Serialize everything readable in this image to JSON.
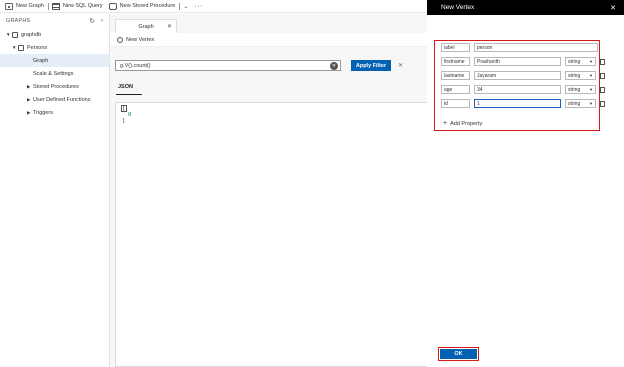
{
  "toolbar": {
    "new_graph": "New Graph",
    "new_sql_query": "New SQL Query",
    "new_stored_procedure": "New Stored Procedure",
    "more": "···"
  },
  "sidebar": {
    "title": "GRAPHS",
    "database": "graphdb",
    "collection": "Persons",
    "items": [
      {
        "label": "Graph",
        "selected": true
      },
      {
        "label": "Scale & Settings",
        "selected": false
      },
      {
        "label": "Stored Procedures",
        "selected": false
      },
      {
        "label": "User Defined Functions",
        "selected": false
      },
      {
        "label": "Triggers",
        "selected": false
      }
    ]
  },
  "main": {
    "tab_label": "Graph",
    "new_vertex_label": "New Vertex",
    "query": "g.V().count()",
    "apply_filter": "Apply Filter",
    "results_tab": "JSON",
    "result_lines": [
      "[",
      "0",
      "]"
    ]
  },
  "panel": {
    "title": "New Vertex",
    "close": "✕",
    "label_key": "label",
    "label_value": "person",
    "properties": [
      {
        "key": "firstname",
        "value": "Prashanth",
        "type": "string"
      },
      {
        "key": "lastname",
        "value": "Jayaram",
        "type": "string"
      },
      {
        "key": "age",
        "value": "34",
        "type": "string"
      },
      {
        "key": "id",
        "value": "1",
        "type": "string"
      }
    ],
    "add_property": "Add Property",
    "ok": "OK"
  },
  "colors": {
    "accent": "#0062b1",
    "highlight_border": "#d71a1a",
    "panel_header": "#000000"
  }
}
